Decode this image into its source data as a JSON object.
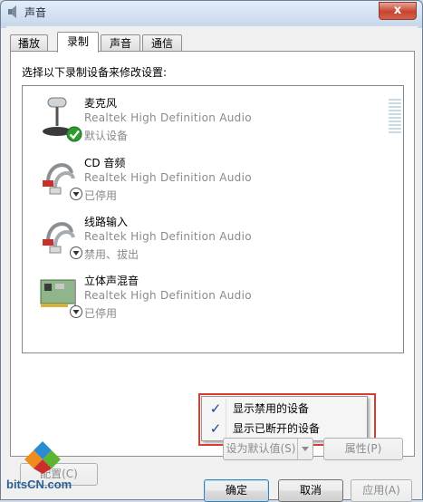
{
  "window": {
    "title": "声音",
    "close_label": "x"
  },
  "tabs": [
    {
      "label": "播放",
      "active": false
    },
    {
      "label": "录制",
      "active": true
    },
    {
      "label": "声音",
      "active": false
    },
    {
      "label": "通信",
      "active": false
    }
  ],
  "panel": {
    "instruction": "选择以下录制设备来修改设置:"
  },
  "devices": [
    {
      "name": "麦克风",
      "driver": "Realtek High Definition Audio",
      "status": "默认设备",
      "icon": "microphone-icon",
      "state_icon": "default-check-icon"
    },
    {
      "name": "CD 音频",
      "driver": "Realtek High Definition Audio",
      "status": "已停用",
      "icon": "rca-cable-icon",
      "state_icon": "disabled-arrow-icon"
    },
    {
      "name": "线路输入",
      "driver": "Realtek High Definition Audio",
      "status": "禁用、拔出",
      "icon": "rca-cable-icon",
      "state_icon": "disabled-arrow-icon"
    },
    {
      "name": "立体声混音",
      "driver": "Realtek High Definition Audio",
      "status": "已停用",
      "icon": "sound-card-icon",
      "state_icon": "disabled-arrow-icon"
    }
  ],
  "context_menu": [
    {
      "label": "显示禁用的设备",
      "checked": true
    },
    {
      "label": "显示已断开的设备",
      "checked": true
    }
  ],
  "buttons": {
    "configure": "配置(C)",
    "set_default": "设为默认值(S)",
    "properties": "属性(P)",
    "ok": "确定",
    "cancel": "取消",
    "apply": "应用(A)"
  },
  "watermark": {
    "text": "bitsCN.com"
  },
  "colors": {
    "highlight_box": "#d93b33",
    "close_button": "#c7452f",
    "default_check": "#2e9b2e"
  }
}
